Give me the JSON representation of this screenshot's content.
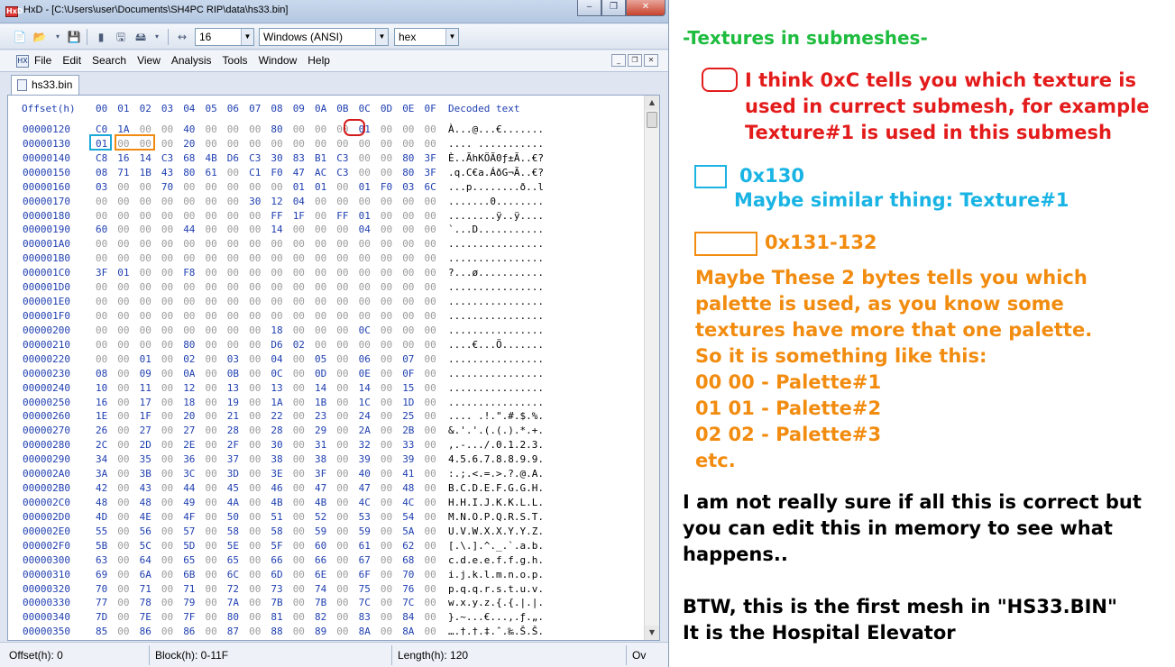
{
  "window": {
    "title": "HxD - [C:\\Users\\user\\Documents\\SH4PC RIP\\data\\hs33.bin]",
    "app_icon": "HxD",
    "minimize": "‒",
    "restore": "❐",
    "close": "✕"
  },
  "toolbar": {
    "bytes_per_row": "16",
    "charset": "Windows (ANSI)",
    "display_mode": "hex"
  },
  "menu": [
    "File",
    "Edit",
    "Search",
    "View",
    "Analysis",
    "Tools",
    "Window",
    "Help"
  ],
  "mdi": {
    "minimize": "_",
    "restore": "❐",
    "close": "✕"
  },
  "tab": {
    "label": "hs33.bin"
  },
  "editor": {
    "offset_header": "Offset(h)",
    "column_headers": [
      "00",
      "01",
      "02",
      "03",
      "04",
      "05",
      "06",
      "07",
      "08",
      "09",
      "0A",
      "0B",
      "0C",
      "0D",
      "0E",
      "0F"
    ],
    "decoded_header": "Decoded text",
    "rows": [
      {
        "off": "00000120",
        "bytes": [
          "C0",
          "1A",
          "00",
          "00",
          "40",
          "00",
          "00",
          "00",
          "80",
          "00",
          "00",
          "00",
          "01",
          "00",
          "00",
          "00"
        ],
        "text": "À...@...€......."
      },
      {
        "off": "00000130",
        "bytes": [
          "01",
          "00",
          "00",
          "00",
          "20",
          "00",
          "00",
          "00",
          "00",
          "00",
          "00",
          "00",
          "00",
          "00",
          "00",
          "00"
        ],
        "text": ".... ..........."
      },
      {
        "off": "00000140",
        "bytes": [
          "C8",
          "16",
          "14",
          "C3",
          "68",
          "4B",
          "D6",
          "C3",
          "30",
          "83",
          "B1",
          "C3",
          "00",
          "00",
          "80",
          "3F"
        ],
        "text": "È..ÃhKÖÃ0ƒ±Ã..€?"
      },
      {
        "off": "00000150",
        "bytes": [
          "08",
          "71",
          "1B",
          "43",
          "80",
          "61",
          "00",
          "C1",
          "F0",
          "47",
          "AC",
          "C3",
          "00",
          "00",
          "80",
          "3F"
        ],
        "text": ".q.C€a.ÁðG¬Ã..€?"
      },
      {
        "off": "00000160",
        "bytes": [
          "03",
          "00",
          "00",
          "70",
          "00",
          "00",
          "00",
          "00",
          "00",
          "01",
          "01",
          "00",
          "01",
          "F0",
          "03",
          "6C"
        ],
        "text": "...p........ð..l"
      },
      {
        "off": "00000170",
        "bytes": [
          "00",
          "00",
          "00",
          "00",
          "00",
          "00",
          "00",
          "30",
          "12",
          "04",
          "00",
          "00",
          "00",
          "00",
          "00",
          "00"
        ],
        "text": ".......0........"
      },
      {
        "off": "00000180",
        "bytes": [
          "00",
          "00",
          "00",
          "00",
          "00",
          "00",
          "00",
          "00",
          "FF",
          "1F",
          "00",
          "FF",
          "01",
          "00",
          "00",
          "00"
        ],
        "text": "........ÿ..ÿ...."
      },
      {
        "off": "00000190",
        "bytes": [
          "60",
          "00",
          "00",
          "00",
          "44",
          "00",
          "00",
          "00",
          "14",
          "00",
          "00",
          "00",
          "04",
          "00",
          "00",
          "00"
        ],
        "text": "`...D..........."
      },
      {
        "off": "000001A0",
        "bytes": [
          "00",
          "00",
          "00",
          "00",
          "00",
          "00",
          "00",
          "00",
          "00",
          "00",
          "00",
          "00",
          "00",
          "00",
          "00",
          "00"
        ],
        "text": "................"
      },
      {
        "off": "000001B0",
        "bytes": [
          "00",
          "00",
          "00",
          "00",
          "00",
          "00",
          "00",
          "00",
          "00",
          "00",
          "00",
          "00",
          "00",
          "00",
          "00",
          "00"
        ],
        "text": "................"
      },
      {
        "off": "000001C0",
        "bytes": [
          "3F",
          "01",
          "00",
          "00",
          "F8",
          "00",
          "00",
          "00",
          "00",
          "00",
          "00",
          "00",
          "00",
          "00",
          "00",
          "00"
        ],
        "text": "?...ø..........."
      },
      {
        "off": "000001D0",
        "bytes": [
          "00",
          "00",
          "00",
          "00",
          "00",
          "00",
          "00",
          "00",
          "00",
          "00",
          "00",
          "00",
          "00",
          "00",
          "00",
          "00"
        ],
        "text": "................"
      },
      {
        "off": "000001E0",
        "bytes": [
          "00",
          "00",
          "00",
          "00",
          "00",
          "00",
          "00",
          "00",
          "00",
          "00",
          "00",
          "00",
          "00",
          "00",
          "00",
          "00"
        ],
        "text": "................"
      },
      {
        "off": "000001F0",
        "bytes": [
          "00",
          "00",
          "00",
          "00",
          "00",
          "00",
          "00",
          "00",
          "00",
          "00",
          "00",
          "00",
          "00",
          "00",
          "00",
          "00"
        ],
        "text": "................"
      },
      {
        "off": "00000200",
        "bytes": [
          "00",
          "00",
          "00",
          "00",
          "00",
          "00",
          "00",
          "00",
          "18",
          "00",
          "00",
          "00",
          "0C",
          "00",
          "00",
          "00"
        ],
        "text": "................"
      },
      {
        "off": "00000210",
        "bytes": [
          "00",
          "00",
          "00",
          "00",
          "80",
          "00",
          "00",
          "00",
          "D6",
          "02",
          "00",
          "00",
          "00",
          "00",
          "00",
          "00"
        ],
        "text": "....€...Ö......."
      },
      {
        "off": "00000220",
        "bytes": [
          "00",
          "00",
          "01",
          "00",
          "02",
          "00",
          "03",
          "00",
          "04",
          "00",
          "05",
          "00",
          "06",
          "00",
          "07",
          "00"
        ],
        "text": "................"
      },
      {
        "off": "00000230",
        "bytes": [
          "08",
          "00",
          "09",
          "00",
          "0A",
          "00",
          "0B",
          "00",
          "0C",
          "00",
          "0D",
          "00",
          "0E",
          "00",
          "0F",
          "00"
        ],
        "text": "................"
      },
      {
        "off": "00000240",
        "bytes": [
          "10",
          "00",
          "11",
          "00",
          "12",
          "00",
          "13",
          "00",
          "13",
          "00",
          "14",
          "00",
          "14",
          "00",
          "15",
          "00"
        ],
        "text": "................"
      },
      {
        "off": "00000250",
        "bytes": [
          "16",
          "00",
          "17",
          "00",
          "18",
          "00",
          "19",
          "00",
          "1A",
          "00",
          "1B",
          "00",
          "1C",
          "00",
          "1D",
          "00"
        ],
        "text": "................"
      },
      {
        "off": "00000260",
        "bytes": [
          "1E",
          "00",
          "1F",
          "00",
          "20",
          "00",
          "21",
          "00",
          "22",
          "00",
          "23",
          "00",
          "24",
          "00",
          "25",
          "00"
        ],
        "text": ".... .!.\".#.$.%."
      },
      {
        "off": "00000270",
        "bytes": [
          "26",
          "00",
          "27",
          "00",
          "27",
          "00",
          "28",
          "00",
          "28",
          "00",
          "29",
          "00",
          "2A",
          "00",
          "2B",
          "00"
        ],
        "text": "&.'.'.(.(.).*.+."
      },
      {
        "off": "00000280",
        "bytes": [
          "2C",
          "00",
          "2D",
          "00",
          "2E",
          "00",
          "2F",
          "00",
          "30",
          "00",
          "31",
          "00",
          "32",
          "00",
          "33",
          "00"
        ],
        "text": ",.-.../.0.1.2.3."
      },
      {
        "off": "00000290",
        "bytes": [
          "34",
          "00",
          "35",
          "00",
          "36",
          "00",
          "37",
          "00",
          "38",
          "00",
          "38",
          "00",
          "39",
          "00",
          "39",
          "00"
        ],
        "text": "4.5.6.7.8.8.9.9."
      },
      {
        "off": "000002A0",
        "bytes": [
          "3A",
          "00",
          "3B",
          "00",
          "3C",
          "00",
          "3D",
          "00",
          "3E",
          "00",
          "3F",
          "00",
          "40",
          "00",
          "41",
          "00"
        ],
        "text": ":.;.<.=.>.?.@.A."
      },
      {
        "off": "000002B0",
        "bytes": [
          "42",
          "00",
          "43",
          "00",
          "44",
          "00",
          "45",
          "00",
          "46",
          "00",
          "47",
          "00",
          "47",
          "00",
          "48",
          "00"
        ],
        "text": "B.C.D.E.F.G.G.H."
      },
      {
        "off": "000002C0",
        "bytes": [
          "48",
          "00",
          "48",
          "00",
          "49",
          "00",
          "4A",
          "00",
          "4B",
          "00",
          "4B",
          "00",
          "4C",
          "00",
          "4C",
          "00"
        ],
        "text": "H.H.I.J.K.K.L.L."
      },
      {
        "off": "000002D0",
        "bytes": [
          "4D",
          "00",
          "4E",
          "00",
          "4F",
          "00",
          "50",
          "00",
          "51",
          "00",
          "52",
          "00",
          "53",
          "00",
          "54",
          "00"
        ],
        "text": "M.N.O.P.Q.R.S.T."
      },
      {
        "off": "000002E0",
        "bytes": [
          "55",
          "00",
          "56",
          "00",
          "57",
          "00",
          "58",
          "00",
          "58",
          "00",
          "59",
          "00",
          "59",
          "00",
          "5A",
          "00"
        ],
        "text": "U.V.W.X.X.Y.Y.Z."
      },
      {
        "off": "000002F0",
        "bytes": [
          "5B",
          "00",
          "5C",
          "00",
          "5D",
          "00",
          "5E",
          "00",
          "5F",
          "00",
          "60",
          "00",
          "61",
          "00",
          "62",
          "00"
        ],
        "text": "[.\\.].^._.`.a.b."
      },
      {
        "off": "00000300",
        "bytes": [
          "63",
          "00",
          "64",
          "00",
          "65",
          "00",
          "65",
          "00",
          "66",
          "00",
          "66",
          "00",
          "67",
          "00",
          "68",
          "00"
        ],
        "text": "c.d.e.e.f.f.g.h."
      },
      {
        "off": "00000310",
        "bytes": [
          "69",
          "00",
          "6A",
          "00",
          "6B",
          "00",
          "6C",
          "00",
          "6D",
          "00",
          "6E",
          "00",
          "6F",
          "00",
          "70",
          "00"
        ],
        "text": "i.j.k.l.m.n.o.p."
      },
      {
        "off": "00000320",
        "bytes": [
          "70",
          "00",
          "71",
          "00",
          "71",
          "00",
          "72",
          "00",
          "73",
          "00",
          "74",
          "00",
          "75",
          "00",
          "76",
          "00"
        ],
        "text": "p.q.q.r.s.t.u.v."
      },
      {
        "off": "00000330",
        "bytes": [
          "77",
          "00",
          "78",
          "00",
          "79",
          "00",
          "7A",
          "00",
          "7B",
          "00",
          "7B",
          "00",
          "7C",
          "00",
          "7C",
          "00"
        ],
        "text": "w.x.y.z.{.{.|.|."
      },
      {
        "off": "00000340",
        "bytes": [
          "7D",
          "00",
          "7E",
          "00",
          "7F",
          "00",
          "80",
          "00",
          "81",
          "00",
          "82",
          "00",
          "83",
          "00",
          "84",
          "00"
        ],
        "text": "}.~...€...‚.ƒ.„."
      },
      {
        "off": "00000350",
        "bytes": [
          "85",
          "00",
          "86",
          "00",
          "86",
          "00",
          "87",
          "00",
          "88",
          "00",
          "89",
          "00",
          "8A",
          "00",
          "8A",
          "00"
        ],
        "text": "….†.†.‡.ˆ.‰.Š.Š."
      }
    ]
  },
  "statusbar": {
    "offset": "Offset(h): 0",
    "block": "Block(h): 0-11F",
    "length": "Length(h): 120",
    "mode": "Ov"
  },
  "annotations": {
    "heading": "-Textures in submeshes-",
    "red_note": [
      "I think 0xC tells you which texture is",
      "used in currect submesh, for example",
      "Texture#1 is used in this submesh"
    ],
    "blue_label": "0x130",
    "blue_note": "Maybe similar thing: Texture#1",
    "orange_label": "0x131-132",
    "orange_note": [
      "Maybe These 2 bytes tells you which",
      "palette is used, as you know some",
      "textures have more that one palette.",
      "So it is something like this:",
      "00 00 - Palette#1",
      "01 01 - Palette#2",
      "02 02 - Palette#3",
      "etc."
    ],
    "black_note": [
      "I am not really sure if all this is correct but",
      "you can edit this in memory to see what",
      "happens.."
    ],
    "btw_note": [
      "BTW, this is the first mesh in \"HS33.BIN\"",
      "It is the Hospital Elevator"
    ]
  },
  "colors": {
    "green": "#1ebc3f",
    "red": "#e31b1b",
    "blue": "#1ab4e4",
    "orange": "#f28c10",
    "hex_nonzero": "#1f3fb0",
    "hex_zero": "#9b9b9b"
  }
}
